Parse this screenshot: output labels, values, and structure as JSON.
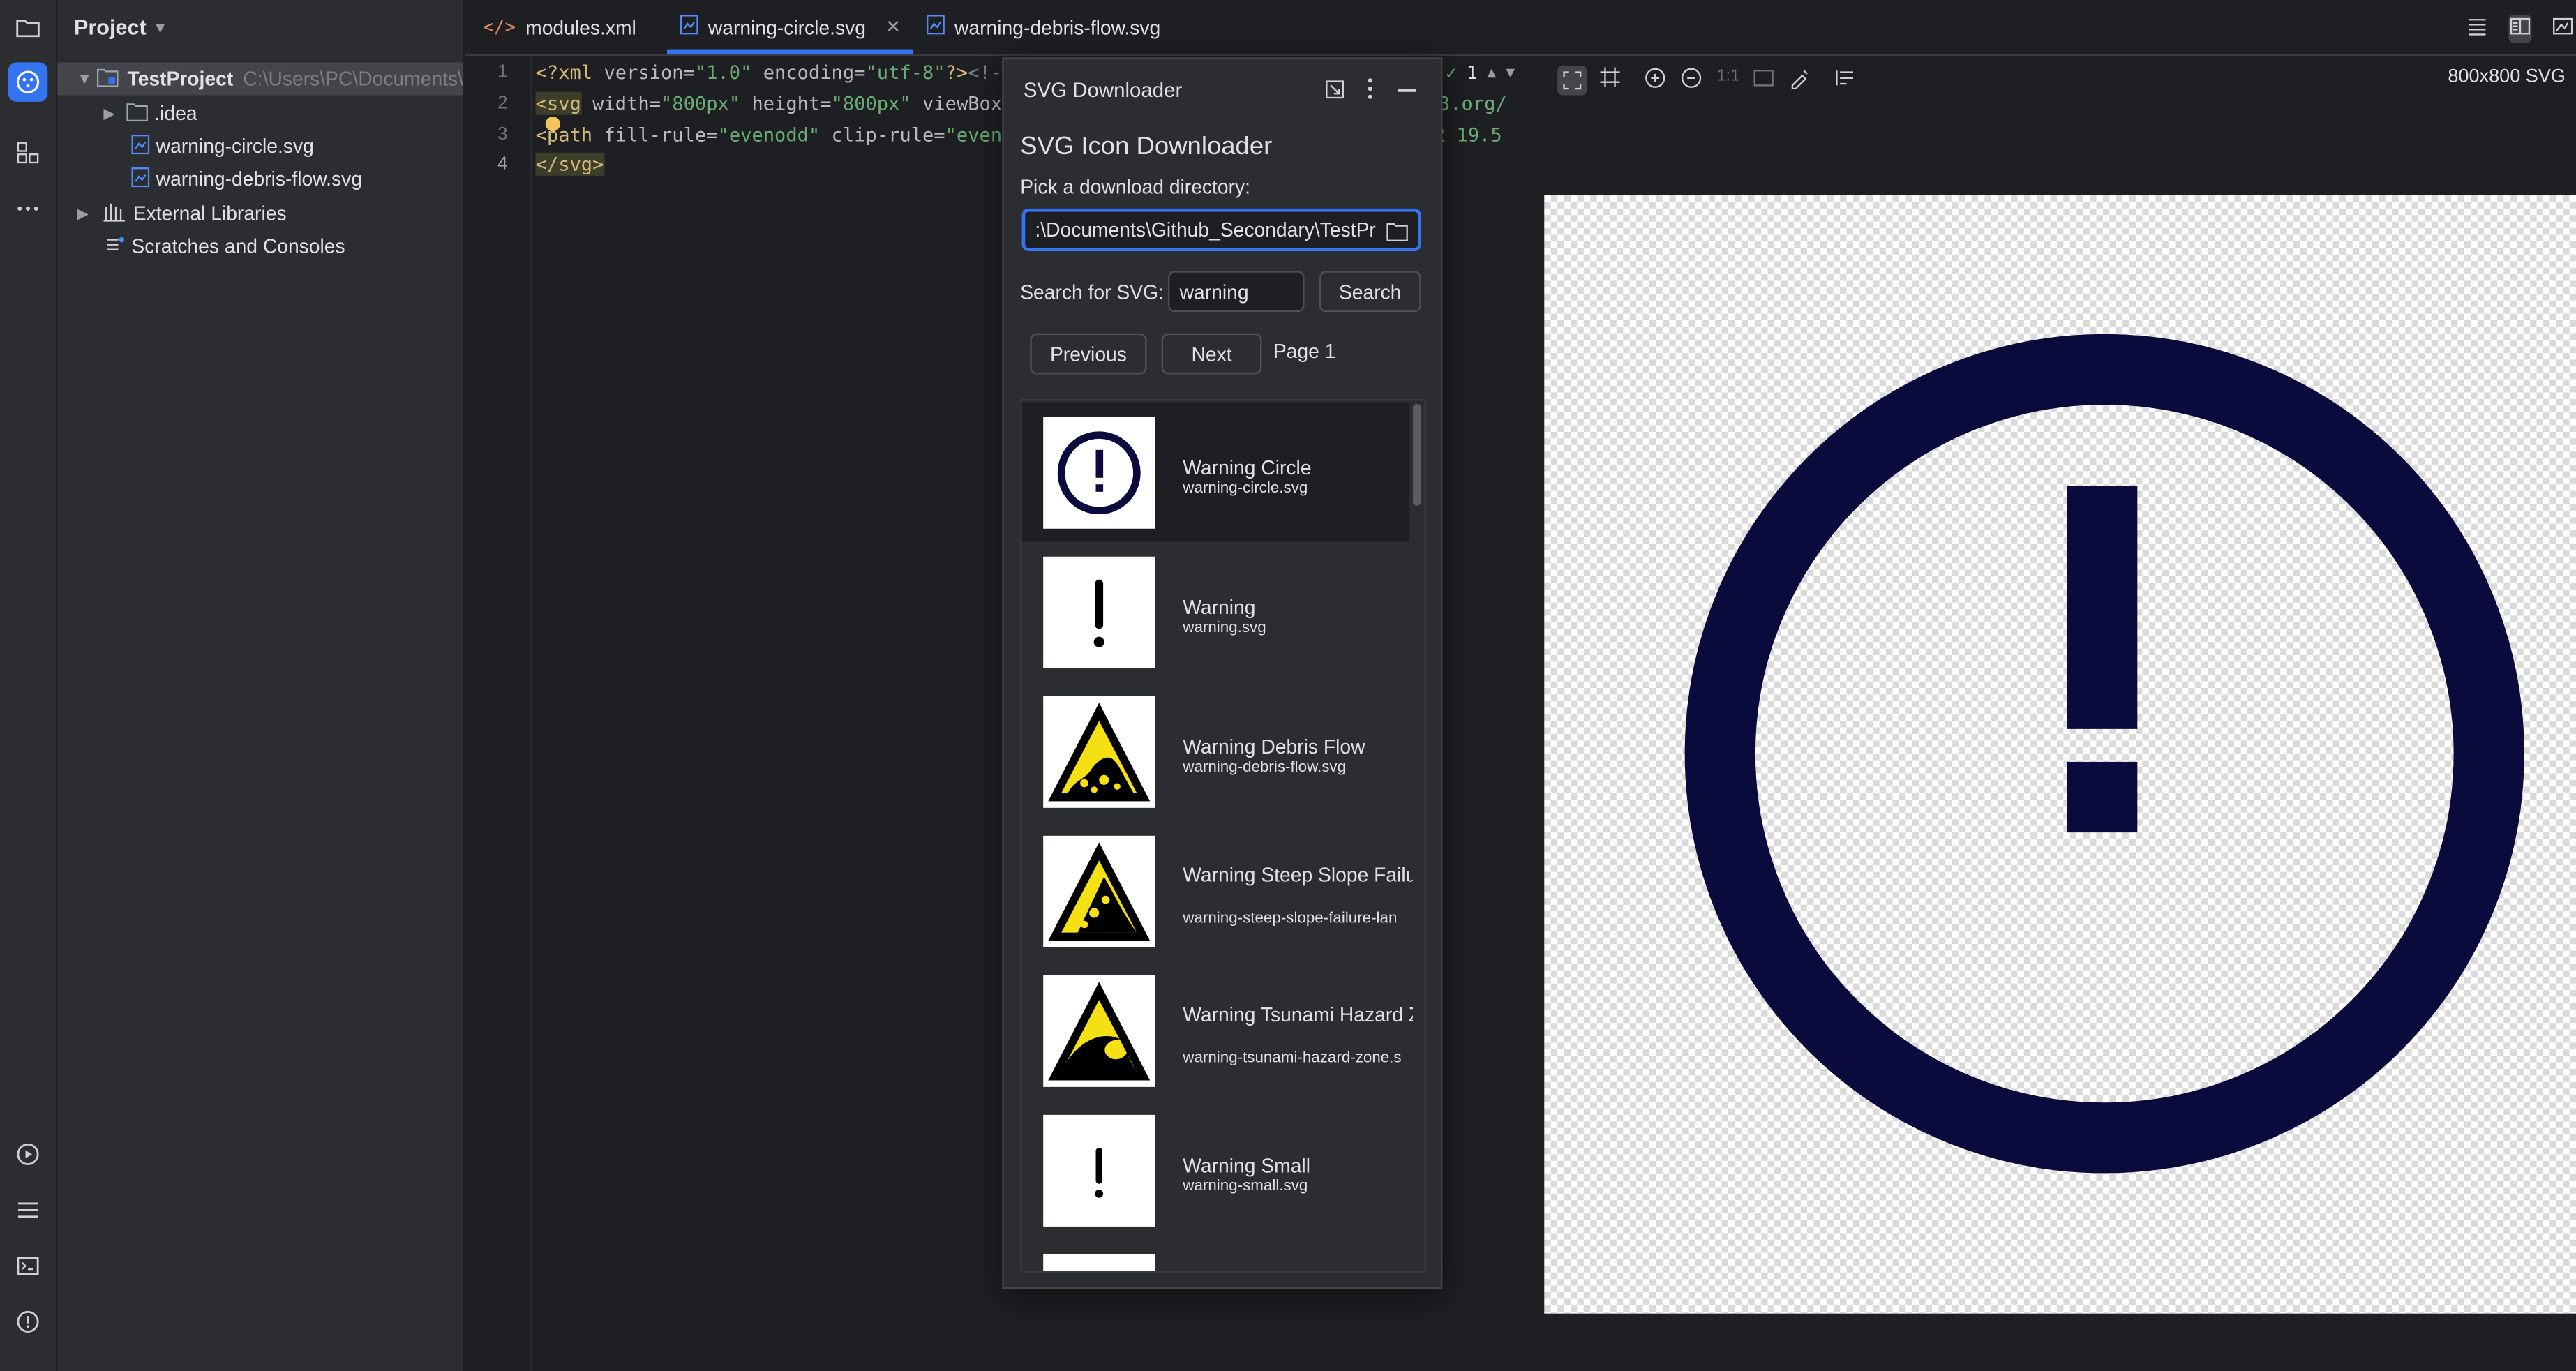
{
  "project_panel": {
    "title": "Project",
    "root_name": "TestProject",
    "root_path": "C:\\Users\\PC\\Documents\\",
    "items": [
      ".idea",
      "warning-circle.svg",
      "warning-debris-flow.svg",
      "External Libraries",
      "Scratches and Consoles"
    ]
  },
  "tabs": [
    {
      "label": "modules.xml"
    },
    {
      "label": "warning-circle.svg"
    },
    {
      "label": "warning-debris-flow.svg"
    }
  ],
  "editor": {
    "line_numbers": [
      "1",
      "2",
      "3",
      "4"
    ],
    "problems_count": "1"
  },
  "preview": {
    "zoom_actual": "1:1",
    "size_label": "800x800 SVG",
    "icon_color": "#0a0a3c"
  },
  "dialog": {
    "title": "SVG Downloader",
    "heading": "SVG Icon Downloader",
    "dir_label": "Pick a download directory:",
    "dir_value": ":\\Documents\\Github_Secondary\\TestPro",
    "search_label": "Search for SVG:",
    "search_value": "warning",
    "search_button": "Search",
    "previous_button": "Previous",
    "next_button": "Next",
    "page_label": "Page 1",
    "results": [
      {
        "name": "Warning Circle",
        "file": "warning-circle.svg",
        "icon": "warning-circle-icon"
      },
      {
        "name": "Warning",
        "file": "warning.svg",
        "icon": "exclamation-icon"
      },
      {
        "name": "Warning Debris Flow",
        "file": "warning-debris-flow.svg",
        "icon": "debris-flow-sign-icon"
      },
      {
        "name": "Warning Steep Slope Failur Landslide",
        "file": "warning-steep-slope-failure-lan",
        "icon": "landslide-sign-icon"
      },
      {
        "name": "Warning Tsunami Hazard Zone",
        "file": "warning-tsunami-hazard-zone.s",
        "icon": "tsunami-sign-icon"
      },
      {
        "name": "Warning Small",
        "file": "warning-small.svg",
        "icon": "exclamation-small-icon"
      }
    ]
  }
}
